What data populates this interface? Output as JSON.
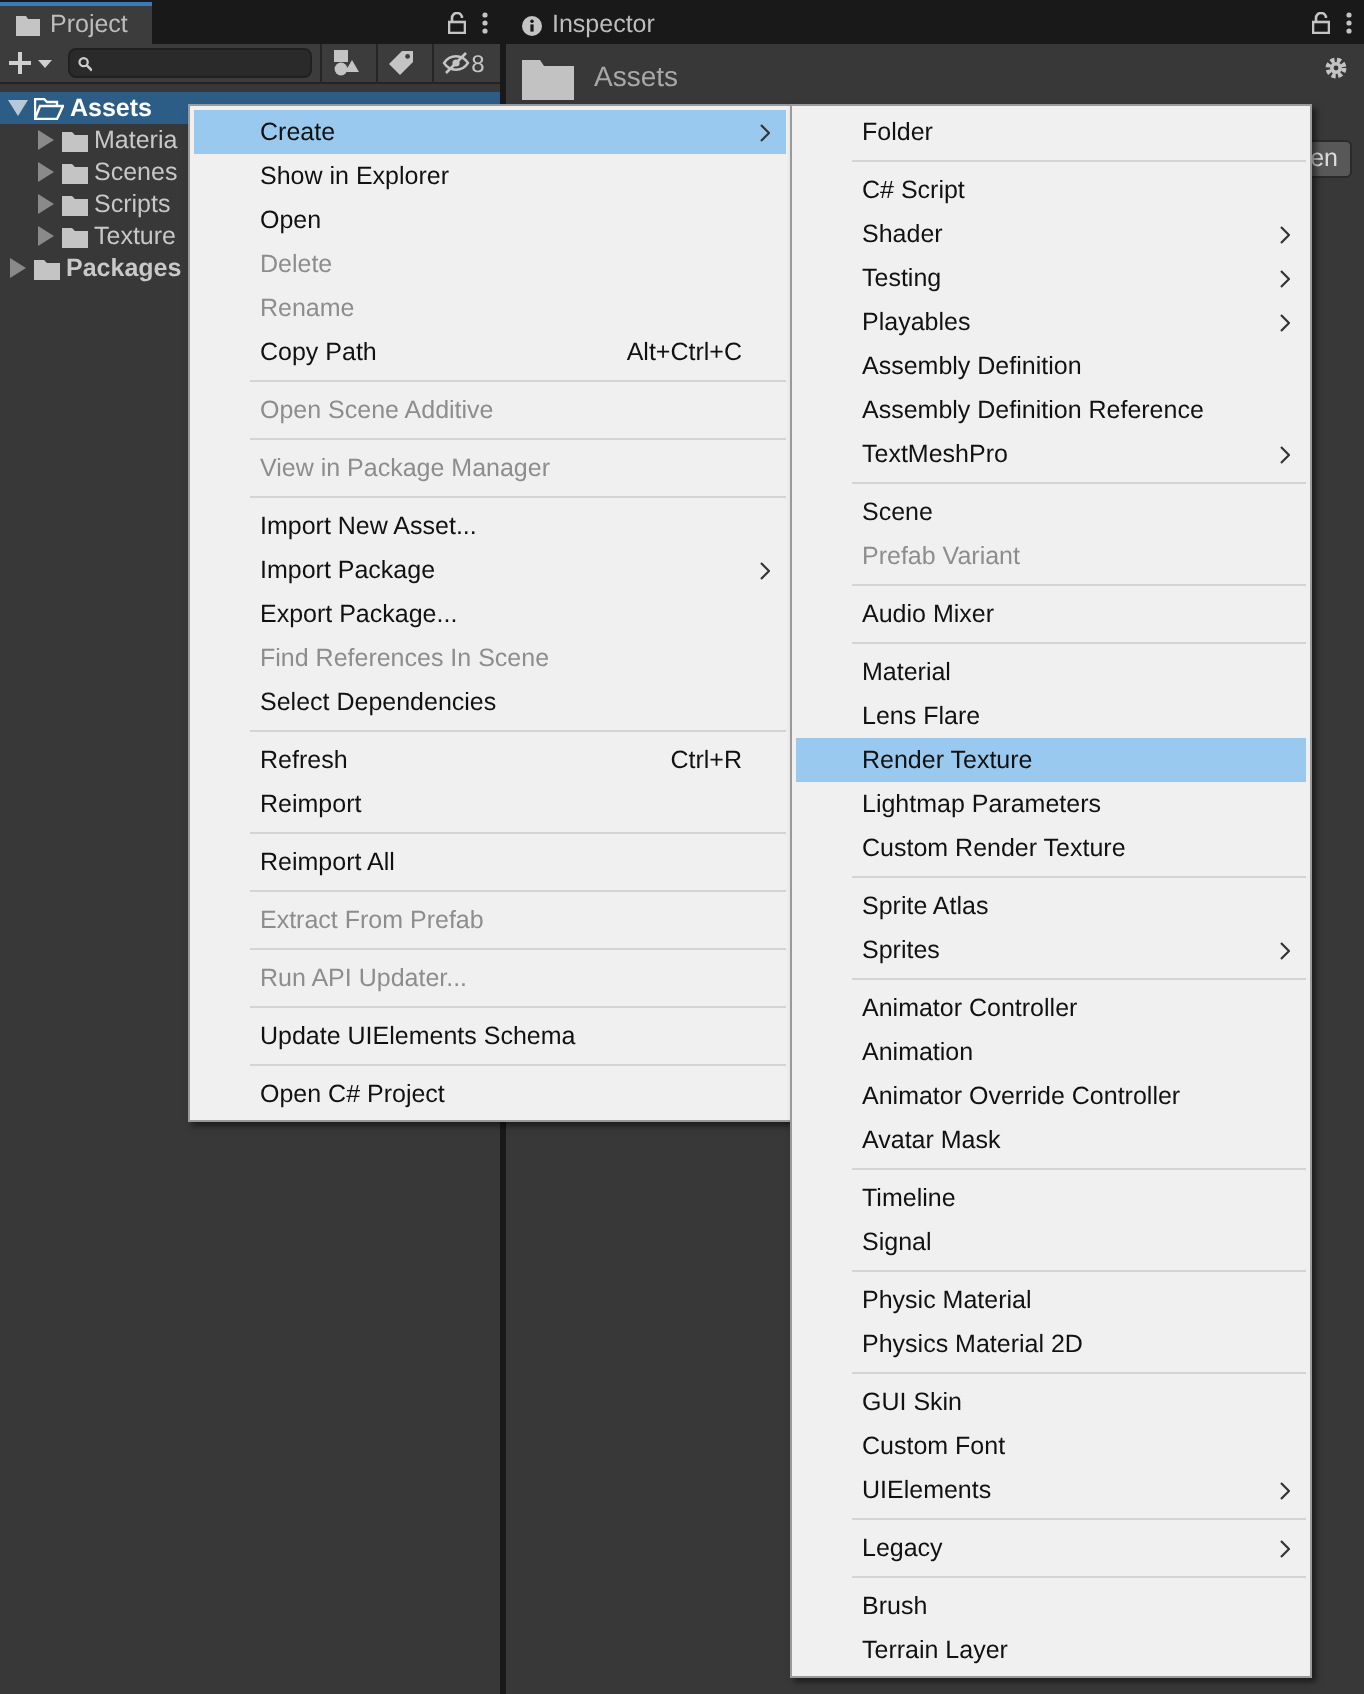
{
  "project_panel": {
    "tab": {
      "label": "Project",
      "selected": true
    },
    "hidden_count": "8",
    "tree": [
      {
        "label": "Assets",
        "selected": true,
        "expanded": true,
        "children": [
          {
            "label": "Materia",
            "selected": false,
            "expanded": false
          },
          {
            "label": "Scenes",
            "selected": false,
            "expanded": false
          },
          {
            "label": "Scripts",
            "selected": false,
            "expanded": false
          },
          {
            "label": "Texture",
            "selected": false,
            "expanded": false
          }
        ]
      },
      {
        "label": "Packages",
        "selected": false,
        "expanded": false
      }
    ]
  },
  "inspector": {
    "tab": {
      "label": "Inspector",
      "selected": false
    },
    "title": "Assets",
    "open_button": "en"
  },
  "context_menu": [
    {
      "kind": "item",
      "label": "Create",
      "selected": true,
      "disabled": false,
      "submenu": true
    },
    {
      "kind": "item",
      "label": "Show in Explorer",
      "selected": false,
      "disabled": false,
      "submenu": false
    },
    {
      "kind": "item",
      "label": "Open",
      "selected": false,
      "disabled": false,
      "submenu": false
    },
    {
      "kind": "item",
      "label": "Delete",
      "selected": false,
      "disabled": true,
      "submenu": false
    },
    {
      "kind": "item",
      "label": "Rename",
      "selected": false,
      "disabled": true,
      "submenu": false
    },
    {
      "kind": "item",
      "label": "Copy Path",
      "shortcut": "Alt+Ctrl+C",
      "selected": false,
      "disabled": false,
      "submenu": false
    },
    {
      "kind": "separator"
    },
    {
      "kind": "item",
      "label": "Open Scene Additive",
      "selected": false,
      "disabled": true,
      "submenu": false
    },
    {
      "kind": "separator"
    },
    {
      "kind": "item",
      "label": "View in Package Manager",
      "selected": false,
      "disabled": true,
      "submenu": false
    },
    {
      "kind": "separator"
    },
    {
      "kind": "item",
      "label": "Import New Asset...",
      "selected": false,
      "disabled": false,
      "submenu": false
    },
    {
      "kind": "item",
      "label": "Import Package",
      "selected": false,
      "disabled": false,
      "submenu": true
    },
    {
      "kind": "item",
      "label": "Export Package...",
      "selected": false,
      "disabled": false,
      "submenu": false
    },
    {
      "kind": "item",
      "label": "Find References In Scene",
      "selected": false,
      "disabled": true,
      "submenu": false
    },
    {
      "kind": "item",
      "label": "Select Dependencies",
      "selected": false,
      "disabled": false,
      "submenu": false
    },
    {
      "kind": "separator"
    },
    {
      "kind": "item",
      "label": "Refresh",
      "shortcut": "Ctrl+R",
      "selected": false,
      "disabled": false,
      "submenu": false
    },
    {
      "kind": "item",
      "label": "Reimport",
      "selected": false,
      "disabled": false,
      "submenu": false
    },
    {
      "kind": "separator"
    },
    {
      "kind": "item",
      "label": "Reimport All",
      "selected": false,
      "disabled": false,
      "submenu": false
    },
    {
      "kind": "separator"
    },
    {
      "kind": "item",
      "label": "Extract From Prefab",
      "selected": false,
      "disabled": true,
      "submenu": false
    },
    {
      "kind": "separator"
    },
    {
      "kind": "item",
      "label": "Run API Updater...",
      "selected": false,
      "disabled": true,
      "submenu": false
    },
    {
      "kind": "separator"
    },
    {
      "kind": "item",
      "label": "Update UIElements Schema",
      "selected": false,
      "disabled": false,
      "submenu": false
    },
    {
      "kind": "separator"
    },
    {
      "kind": "item",
      "label": "Open C# Project",
      "selected": false,
      "disabled": false,
      "submenu": false
    }
  ],
  "create_submenu": [
    {
      "kind": "item",
      "label": "Folder",
      "selected": false,
      "disabled": false,
      "submenu": false
    },
    {
      "kind": "separator"
    },
    {
      "kind": "item",
      "label": "C# Script",
      "selected": false,
      "disabled": false,
      "submenu": false
    },
    {
      "kind": "item",
      "label": "Shader",
      "selected": false,
      "disabled": false,
      "submenu": true
    },
    {
      "kind": "item",
      "label": "Testing",
      "selected": false,
      "disabled": false,
      "submenu": true
    },
    {
      "kind": "item",
      "label": "Playables",
      "selected": false,
      "disabled": false,
      "submenu": true
    },
    {
      "kind": "item",
      "label": "Assembly Definition",
      "selected": false,
      "disabled": false,
      "submenu": false
    },
    {
      "kind": "item",
      "label": "Assembly Definition Reference",
      "selected": false,
      "disabled": false,
      "submenu": false
    },
    {
      "kind": "item",
      "label": "TextMeshPro",
      "selected": false,
      "disabled": false,
      "submenu": true
    },
    {
      "kind": "separator"
    },
    {
      "kind": "item",
      "label": "Scene",
      "selected": false,
      "disabled": false,
      "submenu": false
    },
    {
      "kind": "item",
      "label": "Prefab Variant",
      "selected": false,
      "disabled": true,
      "submenu": false
    },
    {
      "kind": "separator"
    },
    {
      "kind": "item",
      "label": "Audio Mixer",
      "selected": false,
      "disabled": false,
      "submenu": false
    },
    {
      "kind": "separator"
    },
    {
      "kind": "item",
      "label": "Material",
      "selected": false,
      "disabled": false,
      "submenu": false
    },
    {
      "kind": "item",
      "label": "Lens Flare",
      "selected": false,
      "disabled": false,
      "submenu": false
    },
    {
      "kind": "item",
      "label": "Render Texture",
      "selected": true,
      "disabled": false,
      "submenu": false
    },
    {
      "kind": "item",
      "label": "Lightmap Parameters",
      "selected": false,
      "disabled": false,
      "submenu": false
    },
    {
      "kind": "item",
      "label": "Custom Render Texture",
      "selected": false,
      "disabled": false,
      "submenu": false
    },
    {
      "kind": "separator"
    },
    {
      "kind": "item",
      "label": "Sprite Atlas",
      "selected": false,
      "disabled": false,
      "submenu": false
    },
    {
      "kind": "item",
      "label": "Sprites",
      "selected": false,
      "disabled": false,
      "submenu": true
    },
    {
      "kind": "separator"
    },
    {
      "kind": "item",
      "label": "Animator Controller",
      "selected": false,
      "disabled": false,
      "submenu": false
    },
    {
      "kind": "item",
      "label": "Animation",
      "selected": false,
      "disabled": false,
      "submenu": false
    },
    {
      "kind": "item",
      "label": "Animator Override Controller",
      "selected": false,
      "disabled": false,
      "submenu": false
    },
    {
      "kind": "item",
      "label": "Avatar Mask",
      "selected": false,
      "disabled": false,
      "submenu": false
    },
    {
      "kind": "separator"
    },
    {
      "kind": "item",
      "label": "Timeline",
      "selected": false,
      "disabled": false,
      "submenu": false
    },
    {
      "kind": "item",
      "label": "Signal",
      "selected": false,
      "disabled": false,
      "submenu": false
    },
    {
      "kind": "separator"
    },
    {
      "kind": "item",
      "label": "Physic Material",
      "selected": false,
      "disabled": false,
      "submenu": false
    },
    {
      "kind": "item",
      "label": "Physics Material 2D",
      "selected": false,
      "disabled": false,
      "submenu": false
    },
    {
      "kind": "separator"
    },
    {
      "kind": "item",
      "label": "GUI Skin",
      "selected": false,
      "disabled": false,
      "submenu": false
    },
    {
      "kind": "item",
      "label": "Custom Font",
      "selected": false,
      "disabled": false,
      "submenu": false
    },
    {
      "kind": "item",
      "label": "UIElements",
      "selected": false,
      "disabled": false,
      "submenu": true
    },
    {
      "kind": "separator"
    },
    {
      "kind": "item",
      "label": "Legacy",
      "selected": false,
      "disabled": false,
      "submenu": true
    },
    {
      "kind": "separator"
    },
    {
      "kind": "item",
      "label": "Brush",
      "selected": false,
      "disabled": false,
      "submenu": false
    },
    {
      "kind": "item",
      "label": "Terrain Layer",
      "selected": false,
      "disabled": false,
      "submenu": false
    }
  ]
}
